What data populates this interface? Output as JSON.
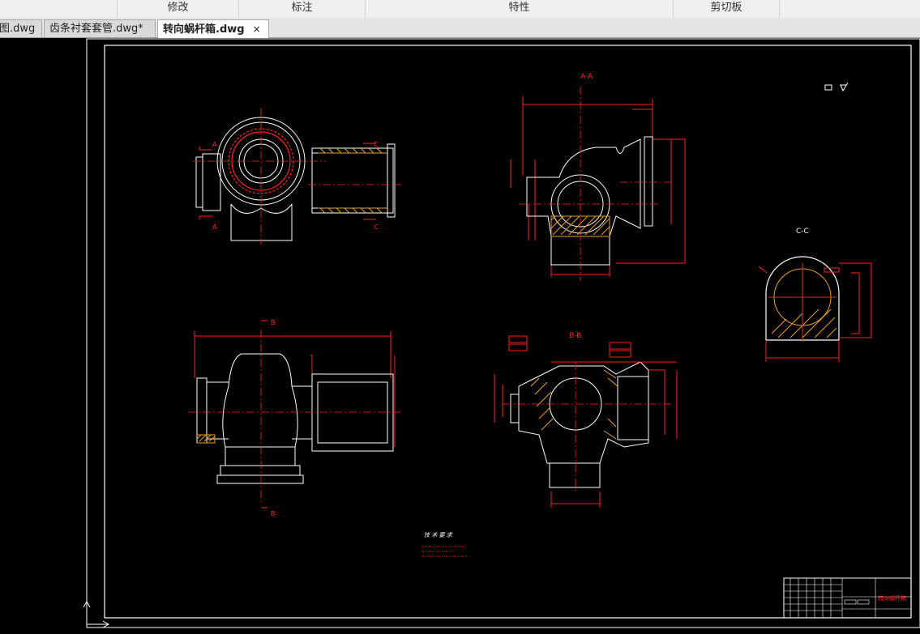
{
  "ribbon": {
    "groups": [
      "",
      "修改",
      "标注",
      "特性",
      "剪切板",
      ""
    ]
  },
  "tabs": [
    {
      "label": "图.dwg"
    },
    {
      "label": "齿条衬套套管.dwg*"
    },
    {
      "label": "转向蜗杆箱.dwg",
      "close": "×"
    }
  ],
  "drawing": {
    "section_labels": {
      "aa": "A-A",
      "bb": "B-B",
      "cc": "C-C",
      "a1": "A",
      "a2": "A",
      "b1": "B",
      "b2": "B",
      "c1": "C",
      "c2": "C"
    },
    "tech_title": "技 术 要 求",
    "title_block_label": "转向蜗杆箱"
  },
  "colors": {
    "background": "#000000",
    "outline": "#ffffff",
    "dimension": "#ff2020",
    "hatch": "#e8a020"
  }
}
